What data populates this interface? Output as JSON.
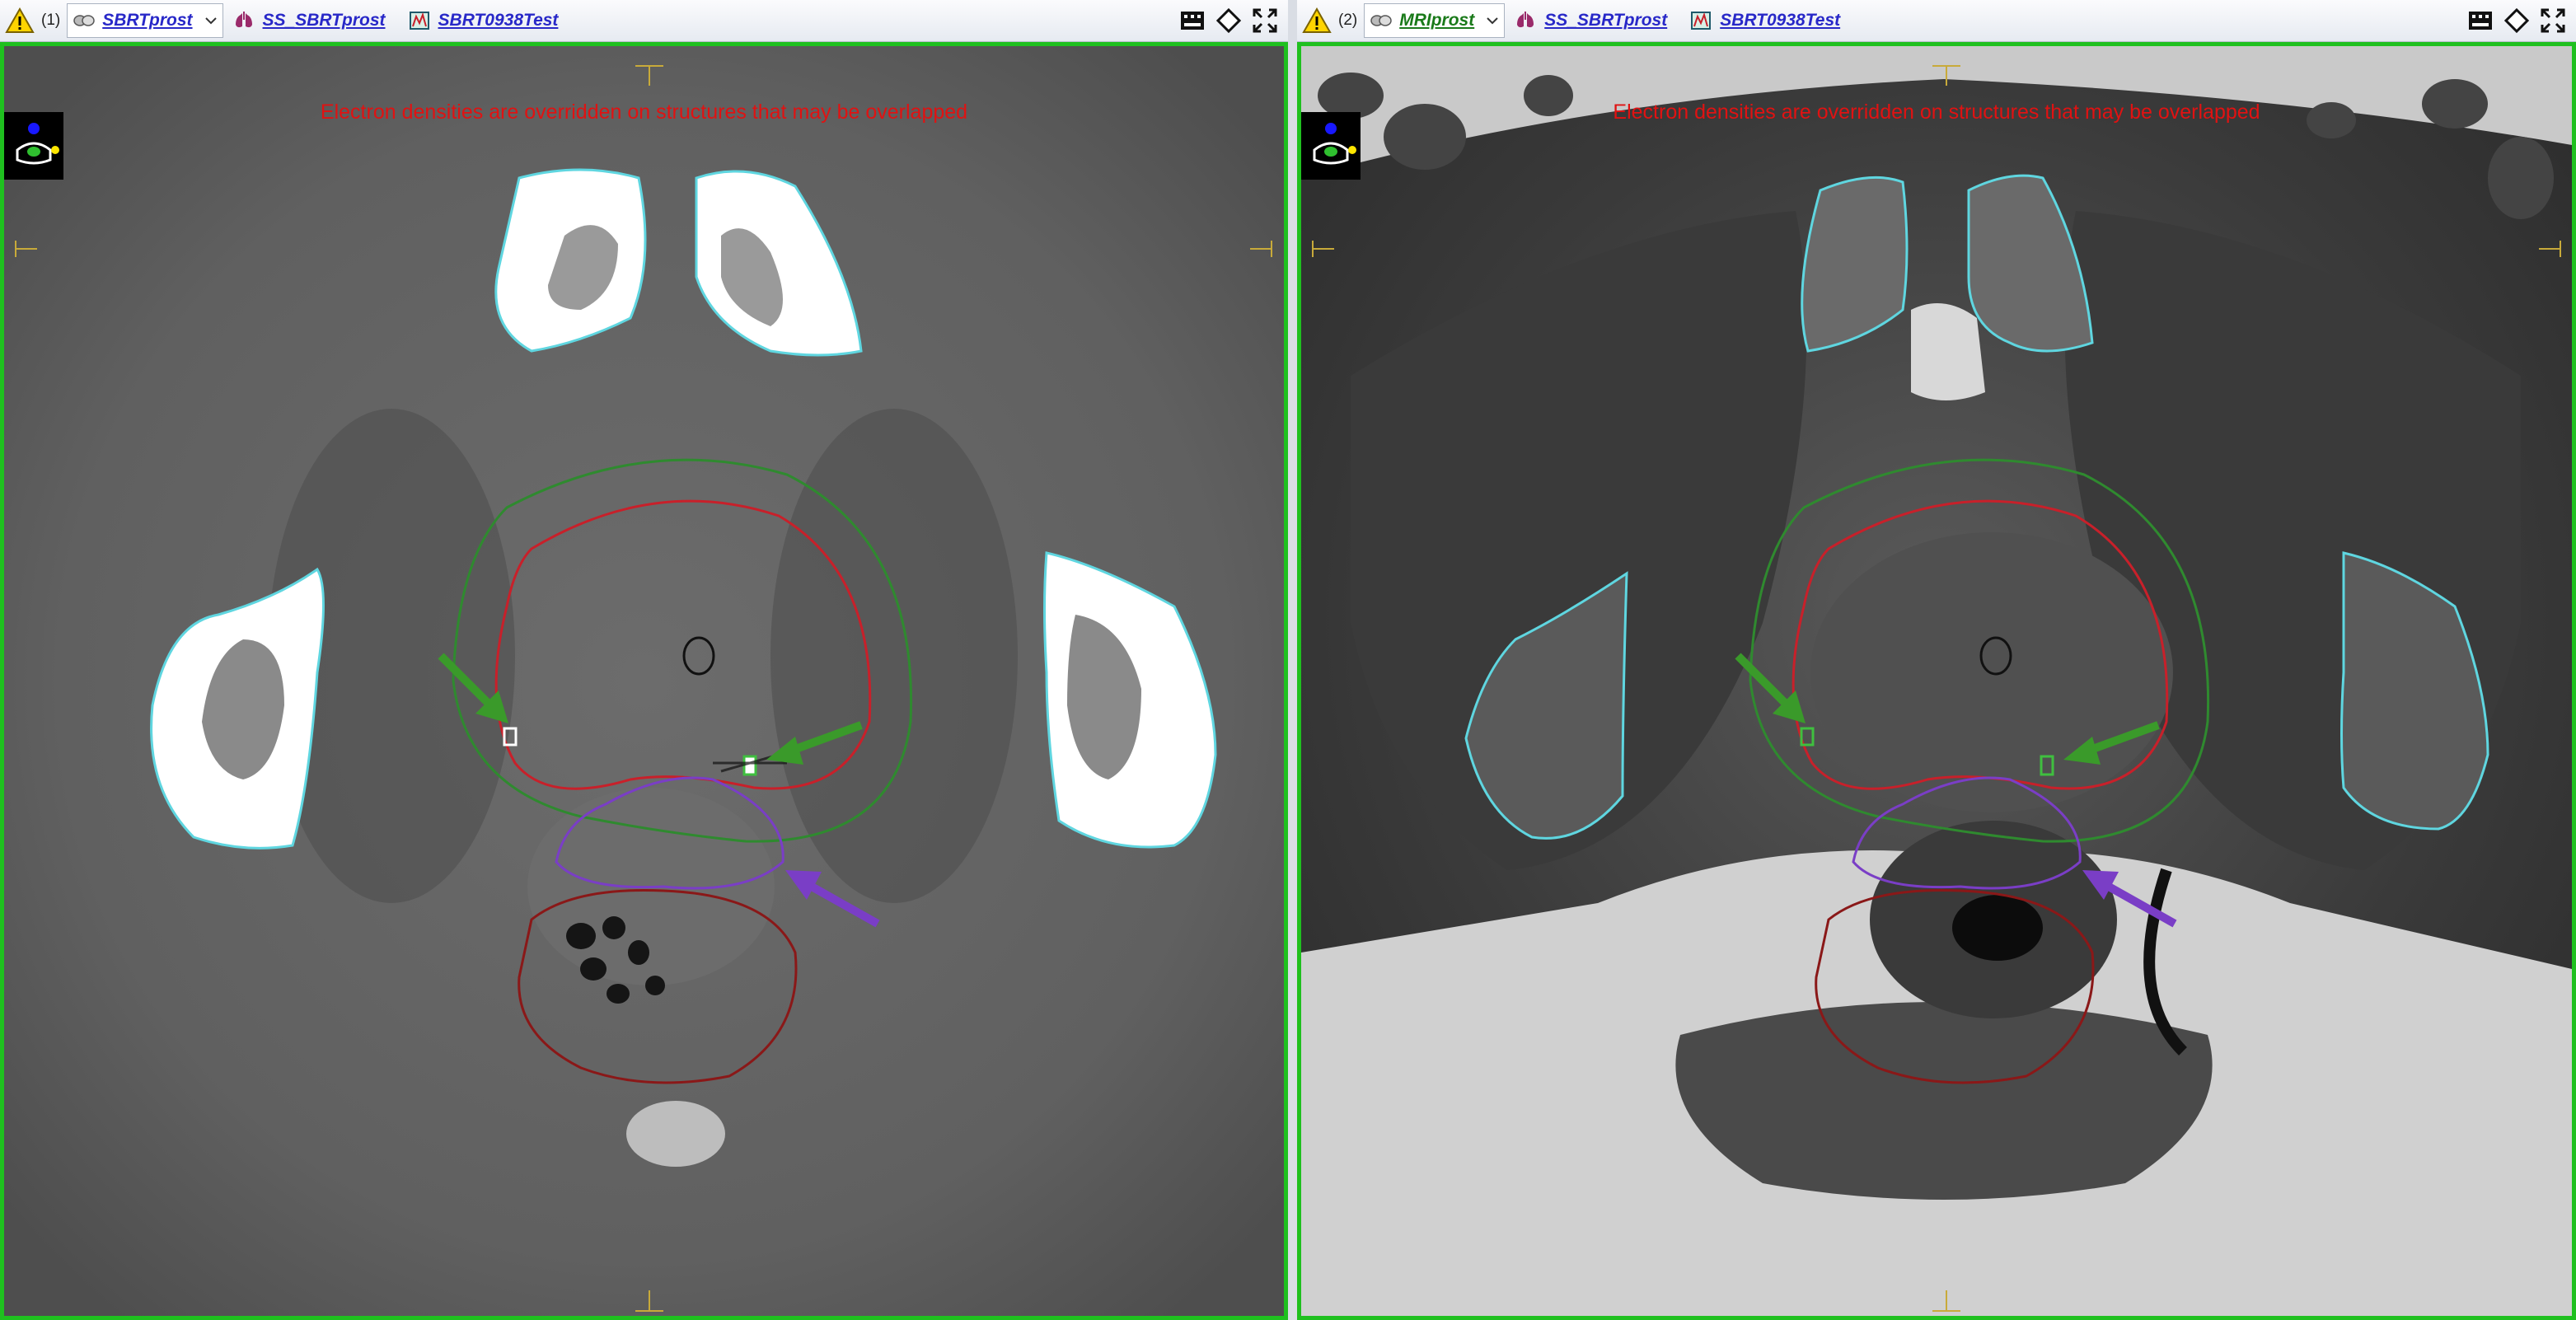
{
  "viewers": [
    {
      "number": "(1)",
      "image_set": "SBRTprost",
      "image_set_color": "#2828c8",
      "structure_set": "SS_SBRTprost",
      "plan": "SBRT0938Test",
      "overlay_warning": "Electron densities are overridden on structures that may be overlapped",
      "modality": "CT",
      "active": true
    },
    {
      "number": "(2)",
      "image_set": "MRIprost",
      "image_set_color": "#1a7a1a",
      "structure_set": "SS_SBRTprost",
      "plan": "SBRT0938Test",
      "overlay_warning": "Electron densities are overridden on structures that may be overlapped",
      "modality": "MR",
      "active": true
    }
  ],
  "icons": {
    "warning": "warning-triangle-icon",
    "image_set": "image-set-icon",
    "structure_set": "lungs-icon",
    "plan": "plan-icon",
    "film": "film-icon",
    "diamond": "diamond-icon",
    "fullscreen": "fullscreen-icon",
    "dropdown": "chevron-down-icon",
    "orientation": "patient-orientation-icon"
  },
  "colors": {
    "active_border": "#1fc01f",
    "overlay_text": "#e01212",
    "bone_contour": "#5fd6e0",
    "prostate_ctv": "#c8202a",
    "ptv": "#2f8a2f",
    "rectal_spacer": "#7a3ec6",
    "rectum": "#8a1818",
    "urethra": "#111111",
    "fiducial": "#3fbf3f",
    "arrow_green": "#3a9a2a",
    "arrow_purple": "#7a3ec6"
  }
}
